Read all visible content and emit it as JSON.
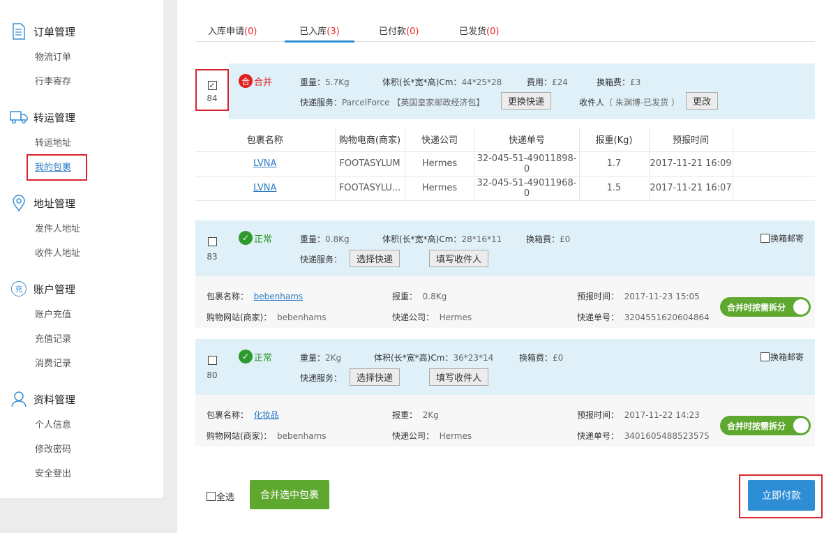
{
  "sidebar": {
    "sections": [
      {
        "title": "订单管理",
        "items": [
          "物流订单",
          "行李寄存"
        ]
      },
      {
        "title": "转运管理",
        "items": [
          "转运地址",
          "我的包裹"
        ]
      },
      {
        "title": "地址管理",
        "items": [
          "发件人地址",
          "收件人地址"
        ]
      },
      {
        "title": "账户管理",
        "items": [
          "账户充值",
          "充值记录",
          "消费记录"
        ]
      },
      {
        "title": "资料管理",
        "items": [
          "个人信息",
          "修改密码",
          "安全登出"
        ]
      }
    ],
    "account_icon_text": "充"
  },
  "tabs": [
    {
      "label": "入库申请",
      "count": "(0)"
    },
    {
      "label": "已入库",
      "count": "(3)"
    },
    {
      "label": "已付款",
      "count": "(0)"
    },
    {
      "label": "已发货",
      "count": "(0)"
    }
  ],
  "pkg1": {
    "checked": "✓",
    "number": "84",
    "status_icon": "合",
    "status": "合并",
    "weight_label": "重量：",
    "weight": "5.7Kg",
    "volume_label": "体积(长*宽*高)Cm：",
    "volume": "44*25*28",
    "fee_label": "费用：",
    "fee": "£24",
    "box_fee_label": "换箱费：",
    "box_fee": "£3",
    "service_label": "快递服务：",
    "service": "ParcelForce 【英国皇家邮政经济包】",
    "change_service_btn": "更换快递",
    "receiver_label": "收件人",
    "receiver": "（ 朱渊博-已发货 ）",
    "change_btn": "更改"
  },
  "table": {
    "headers": [
      "包裹名称",
      "购物电商(商家)",
      "快递公司",
      "快递单号",
      "报重(Kg)",
      "预报时间"
    ],
    "rows": [
      [
        "LVNA",
        "FOOTASYLUM",
        "Hermes",
        "32-045-51-49011898-0",
        "1.7",
        "2017-11-21 16:09"
      ],
      [
        "LVNA",
        "FOOTASYLU...",
        "Hermes",
        "32-045-51-49011968-0",
        "1.5",
        "2017-11-21 16:07"
      ]
    ]
  },
  "pkg2": {
    "number": "83",
    "status_icon": "✓",
    "status": "正常",
    "weight_label": "重量：",
    "weight": "0.8Kg",
    "volume_label": "体积(长*宽*高)Cm：",
    "volume": "28*16*11",
    "box_fee_label": "换箱费：",
    "box_fee": "£0",
    "service_label": "快递服务：",
    "select_btn": "选择快递",
    "fill_btn": "填写收件人",
    "rebox": "换箱邮寄",
    "name_label": "包裹名称：",
    "name": "bebenhams",
    "weight2_label": "报重：",
    "weight2": "0.8Kg",
    "time_label": "预报时间：",
    "time": "2017-11-23 15:05",
    "site_label": "购物网站(商家)：",
    "site": "bebenhams",
    "courier_label": "快递公司：",
    "courier": "Hermes",
    "track_label": "快递单号：",
    "track": "3204551620604864",
    "toggle": "合并时按需拆分"
  },
  "pkg3": {
    "number": "80",
    "status_icon": "✓",
    "status": "正常",
    "weight_label": "重量：",
    "weight": "2Kg",
    "volume_label": "体积(长*宽*高)Cm：",
    "volume": "36*23*14",
    "box_fee_label": "换箱费：",
    "box_fee": "£0",
    "service_label": "快递服务：",
    "select_btn": "选择快递",
    "fill_btn": "填写收件人",
    "rebox": "换箱邮寄",
    "name_label": "包裹名称：",
    "name": "化妆品",
    "weight2_label": "报重：",
    "weight2": "2Kg",
    "time_label": "预报时间：",
    "time": "2017-11-22 14:23",
    "site_label": "购物网站(商家)：",
    "site": "bebenhams",
    "courier_label": "快递公司：",
    "courier": "Hermes",
    "track_label": "快递单号：",
    "track": "3401605488523575",
    "toggle": "合并时按需拆分"
  },
  "footer": {
    "select_all": "全选",
    "merge_btn": "合并选中包裹",
    "pay_btn": "立即付款"
  },
  "colors": {
    "accent": "#2d8ed6",
    "green": "#5fa82f",
    "red": "#d9232d",
    "head_bg": "#dff0f8"
  }
}
